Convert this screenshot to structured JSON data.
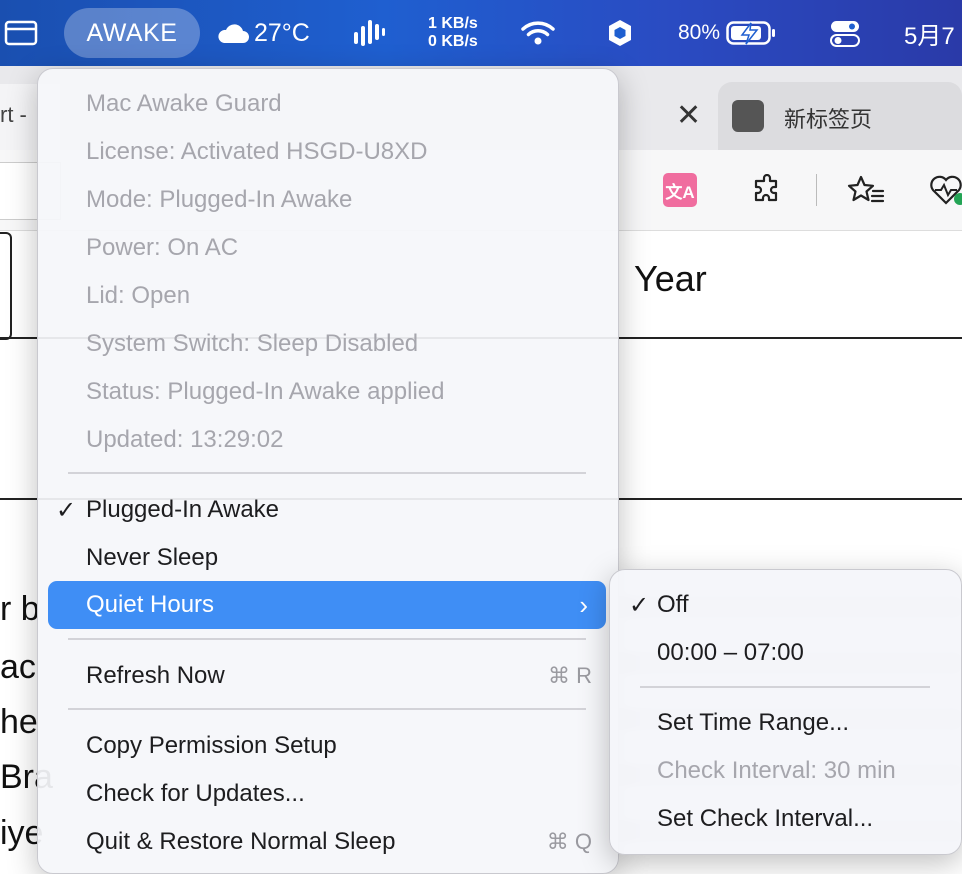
{
  "menubar": {
    "app_status": "AWAKE",
    "weather_temp": "27°C",
    "net_up": "1 KB/s",
    "net_down": "0 KB/s",
    "battery": "80%",
    "date": "5月7"
  },
  "browser": {
    "left_tab_fragment": "rt -",
    "new_tab_label": "新标签页",
    "translate_glyph": "文A",
    "content_heading": "Year",
    "text_fragments": [
      "r b",
      "ac",
      "he",
      "Bra",
      "iye"
    ]
  },
  "menu": {
    "info": [
      "Mac Awake Guard",
      "License: Activated HSGD-U8XD",
      "Mode: Plugged-In Awake",
      "Power: On AC",
      "Lid: Open",
      "System Switch: Sleep Disabled",
      "Status: Plugged-In Awake applied",
      "Updated: 13:29:02"
    ],
    "modes": [
      {
        "label": "Plugged-In Awake",
        "check": "✓"
      },
      {
        "label": "Never Sleep",
        "check": ""
      }
    ],
    "quiet_hours": {
      "label": "Quiet Hours",
      "arrow": "›"
    },
    "refresh": {
      "label": "Refresh Now",
      "shortcut": "⌘ R"
    },
    "copy_permission": {
      "label": "Copy Permission Setup"
    },
    "check_updates": {
      "label": "Check for Updates..."
    },
    "quit": {
      "label": "Quit & Restore Normal Sleep",
      "shortcut": "⌘ Q"
    }
  },
  "submenu": {
    "off": {
      "label": "Off",
      "check": "✓"
    },
    "range": {
      "label": "00:00 – 07:00"
    },
    "set_range": {
      "label": "Set Time Range..."
    },
    "interval": {
      "label": "Check Interval: 30 min"
    },
    "set_interval": {
      "label": "Set Check Interval..."
    }
  },
  "colors": {
    "selection": "#3f8ef5",
    "menubar": "#1f5fd0",
    "disabled_text": "#a6a6ad"
  }
}
